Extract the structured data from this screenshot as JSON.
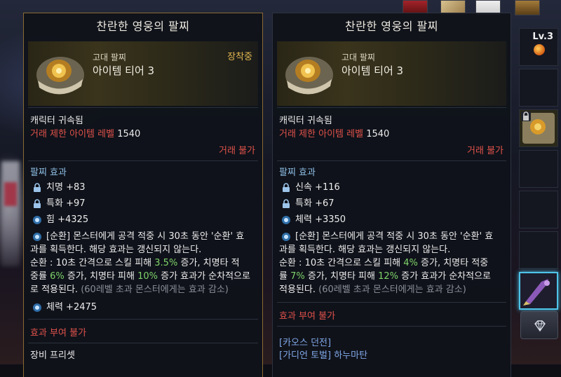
{
  "left": {
    "title": "찬란한 영웅의 팔찌",
    "category": "고대 팔찌",
    "tier": "아이템 티어 3",
    "equipped": "장착중",
    "bound": "캐릭터 귀속됨",
    "level_label": "거래 제한 아이템 레벨",
    "level_value": "1540",
    "no_trade": "거래 불가",
    "effect_header": "팔찌 효과",
    "stats": [
      {
        "name": "치명",
        "value": "+83",
        "icon": "lock-icon"
      },
      {
        "name": "특화",
        "value": "+97",
        "icon": "lock-icon"
      },
      {
        "name": "힘",
        "value": "+4325",
        "icon": "circle-gem-icon"
      }
    ],
    "effect_line1": "[순환] 몬스터에게 공격 적중 시 30초 동안 '순환' 효",
    "effect_line2": "과를 획득한다. 해당 효과는 갱신되지 않는다.",
    "effect_line3_a": "순환 : 10초 간격으로 스킬 피해 ",
    "effect_line3_b": "3.5%",
    "effect_line3_c": " 증가, 치명타 적",
    "effect_line4_a": "중률 ",
    "effect_line4_b": "6%",
    "effect_line4_c": " 증가, 치명타 피해 ",
    "effect_line4_d": "10%",
    "effect_line4_e": " 증가 효과가 순차적으로",
    "effect_line5_a": "로 적용된다.",
    "effect_line5_b": " (60레벨 초과 몬스터에게는 효과 감소)",
    "extra_stat": "체력 +2475",
    "no_enchant": "효과 부여 불가",
    "preset": "장비 프리셋"
  },
  "right": {
    "title": "찬란한 영웅의 팔찌",
    "category": "고대 팔찌",
    "tier": "아이템 티어 3",
    "bound": "캐릭터 귀속됨",
    "level_label": "거래 제한 아이템 레벨",
    "level_value": "1540",
    "no_trade": "거래 불가",
    "effect_header": "팔찌 효과",
    "stats": [
      {
        "name": "신속",
        "value": "+116",
        "icon": "lock-icon"
      },
      {
        "name": "특화",
        "value": "+67",
        "icon": "lock-icon"
      },
      {
        "name": "체력",
        "value": "+3350",
        "icon": "circle-gem-icon"
      }
    ],
    "effect_line1": "[순환] 몬스터에게 공격 적중 시 30초 동안 '순환' 효",
    "effect_line2": "과를 획득한다. 해당 효과는 갱신되지 않는다.",
    "effect_line3_a": "순환 : 10초 간격으로 스킬 피해 ",
    "effect_line3_b": "4%",
    "effect_line3_c": " 증가, 치명타 적중",
    "effect_line4_a": "률 ",
    "effect_line4_b": "7%",
    "effect_line4_c": " 증가, 치명타 피해 ",
    "effect_line4_d": "12%",
    "effect_line4_e": " 증가 효과가 순차적으로",
    "effect_line5_a": "적용된다.",
    "effect_line5_b": " (60레벨 초과 몬스터에게는 효과 감소)",
    "no_enchant": "효과 부여 불가",
    "source1": "[카오스 던전]",
    "source2": "[가디언 토벌] 하누마탄"
  },
  "inventory": {
    "level_badge": "Lv.3"
  },
  "colors": {
    "accent_gold": "#e2b850",
    "warning_red": "#e0524a",
    "info_blue": "#8fbfe6",
    "highlight_green": "#7fd46a",
    "selected_slot": "#4ec3e8"
  }
}
